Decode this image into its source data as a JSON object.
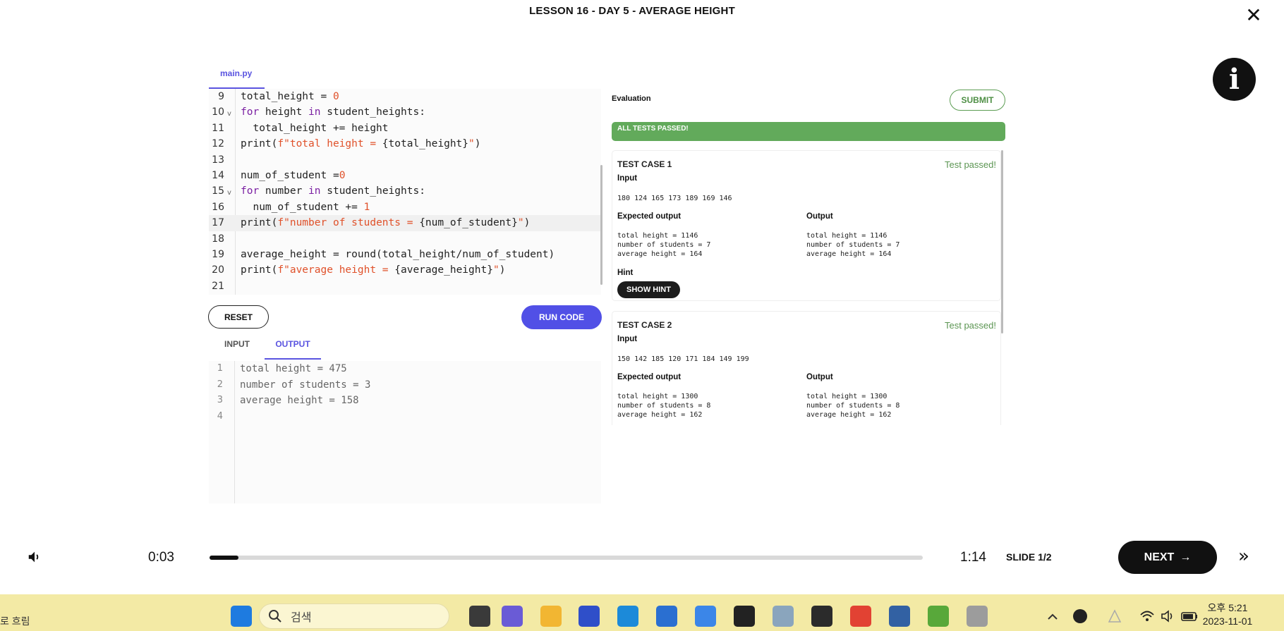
{
  "header": {
    "lesson_title": "LESSON 16 - DAY 5 - AVERAGE HEIGHT",
    "close_symbol": "✕",
    "info_symbol": "i"
  },
  "editor": {
    "file_tab": "main.py",
    "lines": [
      {
        "ln": "9",
        "parts": [
          [
            "",
            "total_height = "
          ],
          [
            "num",
            "0"
          ]
        ]
      },
      {
        "ln": "10",
        "fold": true,
        "parts": [
          [
            "kw",
            "for"
          ],
          [
            "",
            " height "
          ],
          [
            "kw",
            "in"
          ],
          [
            "",
            " student_heights:"
          ]
        ]
      },
      {
        "ln": "11",
        "parts": [
          [
            "",
            "  total_height += height"
          ]
        ]
      },
      {
        "ln": "12",
        "parts": [
          [
            "",
            "print("
          ],
          [
            "str",
            "f\"total height = "
          ],
          [
            "",
            "{total_height}"
          ],
          [
            "str",
            "\""
          ],
          [
            "",
            ")"
          ]
        ]
      },
      {
        "ln": "13",
        "parts": []
      },
      {
        "ln": "14",
        "parts": [
          [
            "",
            "num_of_student ="
          ],
          [
            "num",
            "0"
          ]
        ]
      },
      {
        "ln": "15",
        "fold": true,
        "parts": [
          [
            "kw",
            "for"
          ],
          [
            "",
            " number "
          ],
          [
            "kw",
            "in"
          ],
          [
            "",
            " student_heights:"
          ]
        ]
      },
      {
        "ln": "16",
        "parts": [
          [
            "",
            "  num_of_student += "
          ],
          [
            "num",
            "1"
          ]
        ]
      },
      {
        "ln": "17",
        "active": true,
        "parts": [
          [
            "",
            "print("
          ],
          [
            "str",
            "f\"number of students = "
          ],
          [
            "",
            "{num_of_student}"
          ],
          [
            "str",
            "\""
          ],
          [
            "",
            ")"
          ]
        ]
      },
      {
        "ln": "18",
        "parts": []
      },
      {
        "ln": "19",
        "parts": [
          [
            "",
            "average_height = round(total_height/num_of_student)"
          ]
        ]
      },
      {
        "ln": "20",
        "parts": [
          [
            "",
            "print("
          ],
          [
            "str",
            "f\"average height = "
          ],
          [
            "",
            "{average_height}"
          ],
          [
            "str",
            "\""
          ],
          [
            "",
            ")"
          ]
        ]
      },
      {
        "ln": "21",
        "parts": []
      }
    ],
    "fold_symbol": "v"
  },
  "controls": {
    "reset_label": "RESET",
    "run_label": "RUN CODE"
  },
  "io_tabs": {
    "input_label": "INPUT",
    "output_label": "OUTPUT"
  },
  "output": {
    "lines": [
      {
        "ln": "1",
        "text": "total height = 475"
      },
      {
        "ln": "2",
        "text": "number of students = 3"
      },
      {
        "ln": "3",
        "text": "average height = 158"
      },
      {
        "ln": "4",
        "text": ""
      }
    ]
  },
  "evaluation": {
    "label": "Evaluation",
    "submit_label": "SUBMIT",
    "all_passed": "ALL TESTS PASSED!",
    "input_label": "Input",
    "expected_label": "Expected output",
    "output_label": "Output",
    "hint_label": "Hint",
    "show_hint_label": "SHOW HINT",
    "cases": [
      {
        "title": "TEST CASE 1",
        "status": "Test passed!",
        "input": "180 124 165 173 189 169 146",
        "expected": "total height = 1146\nnumber of students = 7\naverage height = 164",
        "output": "total height = 1146\nnumber of students = 7\naverage height = 164"
      },
      {
        "title": "TEST CASE 2",
        "status": "Test passed!",
        "input": "150 142 185 120 171 184 149 199",
        "expected": "total height = 1300\nnumber of students = 8\naverage height = 162",
        "output": "total height = 1300\nnumber of students = 8\naverage height = 162"
      }
    ]
  },
  "player": {
    "current_time": "0:03",
    "total_time": "1:14",
    "progress_fraction": 0.041,
    "slide_label": "SLIDE 1/2",
    "next_label": "NEXT",
    "next_arrow": "→",
    "skip_symbol": "»"
  },
  "taskbar": {
    "left_text": "로 흐림",
    "search_placeholder": "검색",
    "time": "오후 5:21",
    "date": "2023-11-01",
    "icons": [
      {
        "name": "windows-start-icon",
        "color": "#1e7be0"
      },
      {
        "name": "task-view-icon",
        "color": "#3a3a3a"
      },
      {
        "name": "teams-chat-icon",
        "color": "#6a5bd6"
      },
      {
        "name": "file-explorer-icon",
        "color": "#f2b632"
      },
      {
        "name": "app-c-icon",
        "color": "#2f4fc9"
      },
      {
        "name": "edge-browser-icon",
        "color": "#1c8ad9"
      },
      {
        "name": "ms-store-icon",
        "color": "#2a6fd1"
      },
      {
        "name": "bing-icon",
        "color": "#3b86e8"
      },
      {
        "name": "terminal-icon",
        "color": "#222222"
      },
      {
        "name": "photos-icon",
        "color": "#8aa5bd"
      },
      {
        "name": "sticky-notes-icon",
        "color": "#2b2b2b"
      },
      {
        "name": "chrome-browser-icon",
        "color": "#e24233"
      },
      {
        "name": "app-blue-icon",
        "color": "#3261a3"
      },
      {
        "name": "app-green-icon",
        "color": "#58a83a"
      },
      {
        "name": "typora-icon",
        "color": "#9c9c9c"
      }
    ]
  }
}
